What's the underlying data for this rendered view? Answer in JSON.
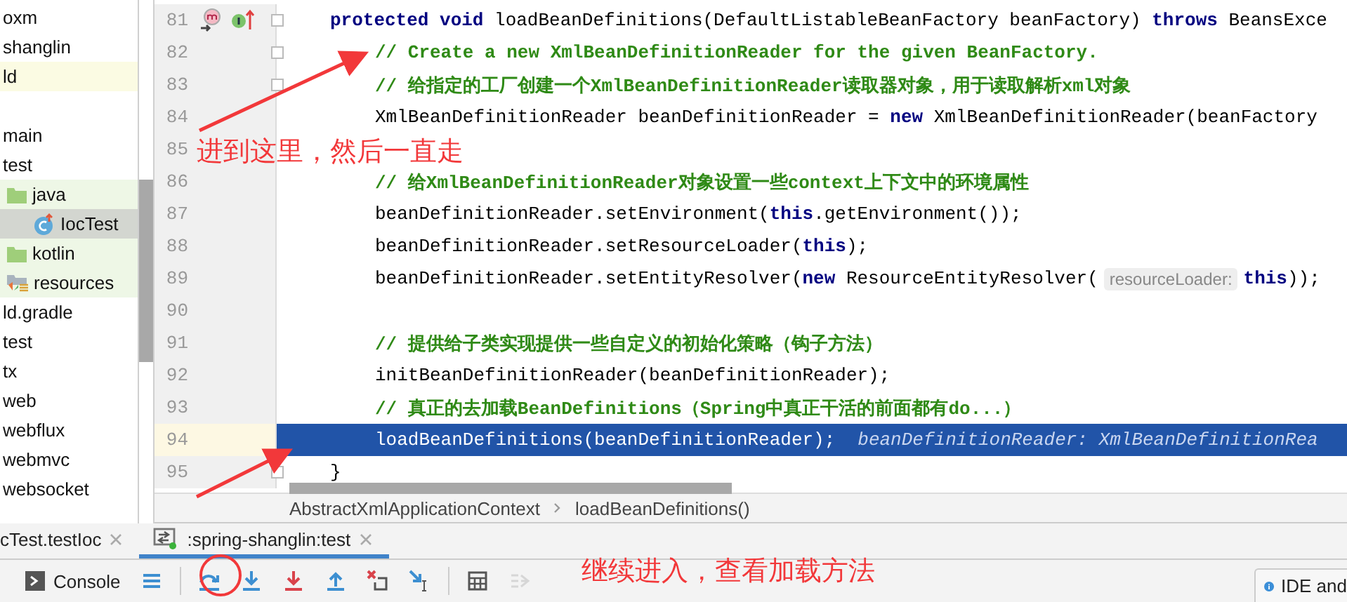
{
  "project_tree": {
    "items": [
      {
        "label": "oxm",
        "kind": "plain",
        "modified": false,
        "test_source": false,
        "selected": false
      },
      {
        "label": "shanglin",
        "kind": "plain",
        "modified": false,
        "test_source": false,
        "selected": false
      },
      {
        "label": "ld",
        "kind": "plain",
        "modified": true,
        "test_source": false,
        "selected": false
      },
      {
        "label": "main",
        "kind": "spaced",
        "modified": false,
        "test_source": false,
        "selected": false
      },
      {
        "label": "test",
        "kind": "plain",
        "modified": false,
        "test_source": false,
        "selected": false,
        "children": [
          {
            "label": "java",
            "kind": "folder",
            "modified": false,
            "test_source": true,
            "selected": false,
            "children": [
              {
                "label": "IocTest",
                "kind": "class",
                "modified": false,
                "test_source": true,
                "selected": true
              }
            ]
          },
          {
            "label": "kotlin",
            "kind": "folder",
            "modified": false,
            "test_source": true,
            "selected": false
          },
          {
            "label": "resources",
            "kind": "resources",
            "modified": false,
            "test_source": true,
            "selected": false
          }
        ]
      },
      {
        "label": "ld.gradle",
        "kind": "plain",
        "modified": false,
        "test_source": false,
        "selected": false
      },
      {
        "label": "test",
        "kind": "plain",
        "modified": false,
        "test_source": false,
        "selected": false
      },
      {
        "label": "tx",
        "kind": "plain",
        "modified": false,
        "test_source": false,
        "selected": false
      },
      {
        "label": "web",
        "kind": "plain",
        "modified": false,
        "test_source": false,
        "selected": false
      },
      {
        "label": "webflux",
        "kind": "plain",
        "modified": false,
        "test_source": false,
        "selected": false
      },
      {
        "label": "webmvc",
        "kind": "plain",
        "modified": false,
        "test_source": false,
        "selected": false
      },
      {
        "label": "websocket",
        "kind": "plain",
        "modified": false,
        "test_source": false,
        "selected": false
      }
    ]
  },
  "editor": {
    "lines": [
      {
        "number": "81",
        "markers": [
          {
            "kind": "override"
          },
          {
            "kind": "implement"
          }
        ],
        "fold": true,
        "indented": false,
        "execution_point": false,
        "segments": [
          {
            "kind": "keyword",
            "text": "protected void"
          },
          {
            "kind": "plain",
            "text": " loadBeanDefinitions(DefaultListableBeanFactory beanFactory) "
          },
          {
            "kind": "keyword",
            "text": "throws"
          },
          {
            "kind": "plain",
            "text": " BeansExce"
          }
        ]
      },
      {
        "number": "82",
        "fold": true,
        "indented": true,
        "execution_point": false,
        "segments": [
          {
            "kind": "comment",
            "text": "// Create a new XmlBeanDefinitionReader for the given BeanFactory."
          }
        ]
      },
      {
        "number": "83",
        "fold": true,
        "indented": true,
        "execution_point": false,
        "segments": [
          {
            "kind": "comment",
            "text": "// 给指定的工厂创建一个XmlBeanDefinitionReader读取器对象，用于读取解析xml对象"
          }
        ]
      },
      {
        "number": "84",
        "fold": false,
        "indented": true,
        "execution_point": false,
        "segments": [
          {
            "kind": "plain",
            "text": "XmlBeanDefinitionReader beanDefinitionReader = "
          },
          {
            "kind": "keyword",
            "text": "new"
          },
          {
            "kind": "plain",
            "text": " XmlBeanDefinitionReader(beanFactory"
          }
        ]
      },
      {
        "number": "85",
        "fold": false,
        "execution_point": false
      },
      {
        "number": "86",
        "fold": false,
        "indented": true,
        "execution_point": false,
        "segments": [
          {
            "kind": "comment",
            "text": "// 给XmlBeanDefinitionReader对象设置一些context上下文中的环境属性"
          }
        ]
      },
      {
        "number": "87",
        "fold": false,
        "indented": true,
        "execution_point": false,
        "segments": [
          {
            "kind": "plain",
            "text": "beanDefinitionReader.setEnvironment("
          },
          {
            "kind": "keyword",
            "text": "this"
          },
          {
            "kind": "plain",
            "text": ".getEnvironment());"
          }
        ]
      },
      {
        "number": "88",
        "fold": false,
        "indented": true,
        "execution_point": false,
        "segments": [
          {
            "kind": "plain",
            "text": "beanDefinitionReader.setResourceLoader("
          },
          {
            "kind": "keyword",
            "text": "this"
          },
          {
            "kind": "plain",
            "text": ");"
          }
        ]
      },
      {
        "number": "89",
        "fold": false,
        "indented": true,
        "execution_point": false,
        "segments": [
          {
            "kind": "plain",
            "text": "beanDefinitionReader.setEntityResolver("
          },
          {
            "kind": "keyword",
            "text": "new"
          },
          {
            "kind": "plain",
            "text": " ResourceEntityResolver("
          },
          {
            "kind": "param_hint",
            "text": "resourceLoader:"
          },
          {
            "kind": "keyword",
            "text": "this"
          },
          {
            "kind": "plain",
            "text": "));"
          }
        ]
      },
      {
        "number": "90",
        "fold": false,
        "execution_point": false
      },
      {
        "number": "91",
        "fold": false,
        "indented": true,
        "execution_point": false,
        "segments": [
          {
            "kind": "comment",
            "text": "// 提供给子类实现提供一些自定义的初始化策略（钩子方法）"
          }
        ]
      },
      {
        "number": "92",
        "fold": false,
        "indented": true,
        "execution_point": false,
        "segments": [
          {
            "kind": "plain",
            "text": "initBeanDefinitionReader(beanDefinitionReader);"
          }
        ]
      },
      {
        "number": "93",
        "fold": false,
        "indented": true,
        "execution_point": false,
        "segments": [
          {
            "kind": "comment",
            "text": "// 真正的去加载BeanDefinitions（Spring中真正干活的前面都有do...）"
          }
        ]
      },
      {
        "number": "94",
        "fold": false,
        "indented": true,
        "execution_point": true,
        "segments": [
          {
            "kind": "plain",
            "text": "loadBeanDefinitions(beanDefinitionReader);"
          },
          {
            "kind": "value_hint",
            "text": "beanDefinitionReader: XmlBeanDefinitionRea"
          }
        ]
      },
      {
        "number": "95",
        "fold": true,
        "indented": false,
        "execution_point": false,
        "segments": [
          {
            "kind": "plain",
            "text": "}"
          }
        ]
      }
    ],
    "breadcrumbs": [
      "AbstractXmlApplicationContext",
      "loadBeanDefinitions()"
    ]
  },
  "run_tabs": [
    {
      "label": "cTest.testIoc",
      "kind": "plain",
      "selected": false
    },
    {
      "label": ":spring-shanglin:test",
      "kind": "gradle",
      "selected": true
    }
  ],
  "toolbar": [
    {
      "kind": "console",
      "label": "Console",
      "disabled": false
    },
    {
      "kind": "menu",
      "disabled": false
    },
    {
      "kind": "step-over",
      "disabled": false
    },
    {
      "kind": "step-into",
      "disabled": false
    },
    {
      "kind": "force-step-into",
      "disabled": false
    },
    {
      "kind": "step-out",
      "disabled": false
    },
    {
      "kind": "drop-frame",
      "disabled": false
    },
    {
      "kind": "run-to-cursor",
      "disabled": false
    },
    {
      "kind": "evaluate",
      "disabled": false
    },
    {
      "kind": "trace",
      "disabled": true
    }
  ],
  "notification": {
    "text": "IDE and"
  },
  "annotations": [
    {
      "text": "进到这里，然后一直走"
    },
    {
      "text": "继续进入，查看加载方法"
    }
  ]
}
